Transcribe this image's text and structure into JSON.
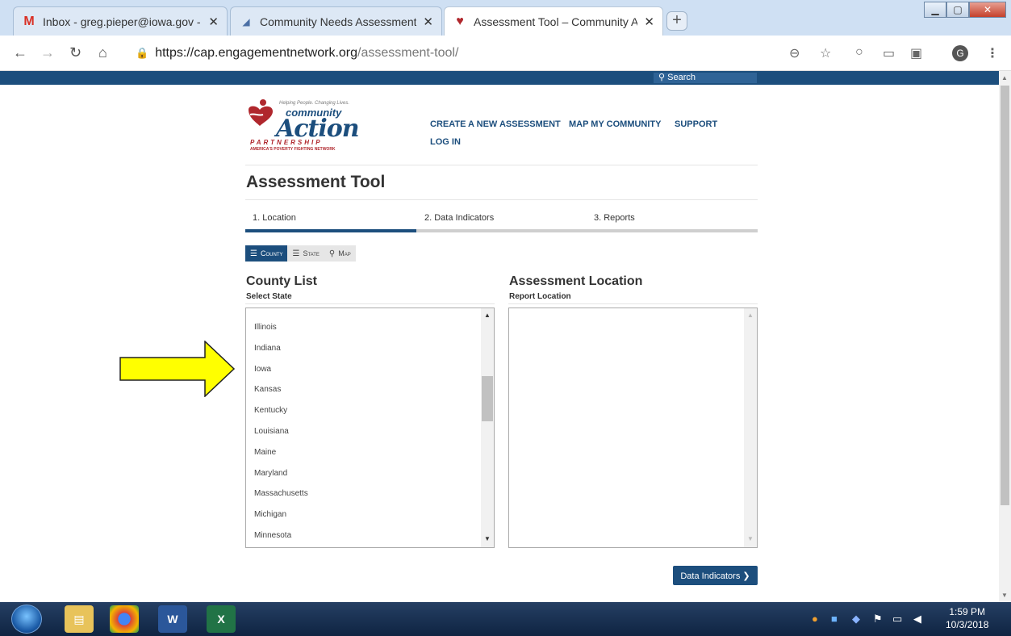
{
  "browser": {
    "tabs": [
      {
        "title": "Inbox - greg.pieper@iowa.gov - ",
        "favicon": "gmail-icon"
      },
      {
        "title": "Community Needs Assessment T",
        "favicon": "cna-icon"
      },
      {
        "title": "Assessment Tool – Community A",
        "favicon": "cap-heart-icon",
        "active": true
      }
    ],
    "tab_close_glyph": "✕",
    "new_tab_glyph": "+",
    "url_host": "https://cap.engagementnetwork.org",
    "url_path": "/assessment-tool/",
    "profile_initial": "G",
    "window_buttons": {
      "minimize": "▁",
      "maximize": "▢",
      "close": "✕"
    }
  },
  "site": {
    "search_label": "Search",
    "logo": {
      "tagline": "Helping People. Changing Lives.",
      "word1": "community",
      "word2": "Action",
      "word3": "PARTNERSHIP",
      "word4": "AMERICA'S POVERTY FIGHTING NETWORK"
    },
    "nav": {
      "create": "CREATE A NEW ASSESSMENT",
      "map": "MAP MY COMMUNITY",
      "support": "SUPPORT",
      "login": "LOG IN"
    },
    "page_title": "Assessment Tool",
    "steps": [
      "1. Location",
      "2. Data Indicators",
      "3. Reports"
    ],
    "active_step_index": 0,
    "view_tabs": [
      "County",
      "State",
      "Map"
    ],
    "active_view": "County",
    "county_list": {
      "heading": "County List",
      "subheading": "Select State",
      "items": [
        "Illinois",
        "Indiana",
        "Iowa",
        "Kansas",
        "Kentucky",
        "Louisiana",
        "Maine",
        "Maryland",
        "Massachusetts",
        "Michigan",
        "Minnesota"
      ]
    },
    "assessment_location": {
      "heading": "Assessment Location",
      "subheading": "Report Location",
      "items": []
    },
    "next_button": "Data Indicators ❯"
  },
  "annotation": {
    "arrow_color": "#ffff00",
    "points_to": "Iowa"
  },
  "taskbar": {
    "time": "1:59 PM",
    "date": "10/3/2018",
    "apps": [
      "explorer-icon",
      "chrome-icon",
      "word-icon",
      "excel-icon"
    ]
  },
  "colors": {
    "brand_blue": "#1c4e7d",
    "brand_red": "#b0272d",
    "arrow_yellow": "#ffff00"
  }
}
